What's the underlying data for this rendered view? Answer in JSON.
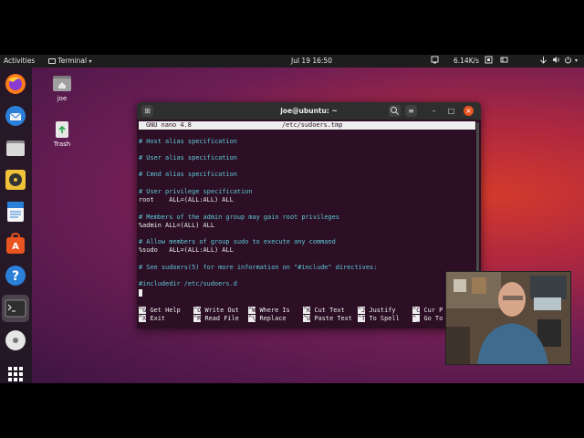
{
  "topbar": {
    "activities": "Activities",
    "app_menu": "Terminal",
    "datetime": "Jul 19  16:50",
    "net_speed": "6.14K/s"
  },
  "desktop": {
    "icons": [
      {
        "label": "joe"
      },
      {
        "label": "Trash"
      }
    ]
  },
  "terminal": {
    "title": "joe@ubuntu: ~",
    "nano_header": {
      "version": "GNU nano 4.8",
      "filename": "/etc/sudoers.tmp"
    },
    "lines": [
      "# Host alias specification",
      "# User alias specification",
      "# Cmnd alias specification",
      "# User privilege specification",
      "root    ALL=(ALL:ALL) ALL",
      "# Members of the admin group may gain root privileges",
      "%admin ALL=(ALL) ALL",
      "# Allow members of group sudo to execute any command",
      "%sudo   ALL=(ALL:ALL) ALL",
      "# See sudoers(5) for more information on \"#include\" directives:",
      "#includedir /etc/sudoers.d"
    ],
    "shortcuts": [
      {
        "key": "^G",
        "label": "Get Help"
      },
      {
        "key": "^O",
        "label": "Write Out"
      },
      {
        "key": "^W",
        "label": "Where Is"
      },
      {
        "key": "^K",
        "label": "Cut Text"
      },
      {
        "key": "^J",
        "label": "Justify"
      },
      {
        "key": "^C",
        "label": "Cur P"
      },
      {
        "key": "^X",
        "label": "Exit"
      },
      {
        "key": "^R",
        "label": "Read File"
      },
      {
        "key": "^\\",
        "label": "Replace"
      },
      {
        "key": "^U",
        "label": "Paste Text"
      },
      {
        "key": "^T",
        "label": "To Spell"
      },
      {
        "key": "^_",
        "label": "Go To"
      }
    ]
  },
  "colors": {
    "desktop_accent": "#b0283f",
    "terminal_bg": "#2c0f24",
    "comment": "#5ec8d8",
    "close_button": "#e95420"
  }
}
